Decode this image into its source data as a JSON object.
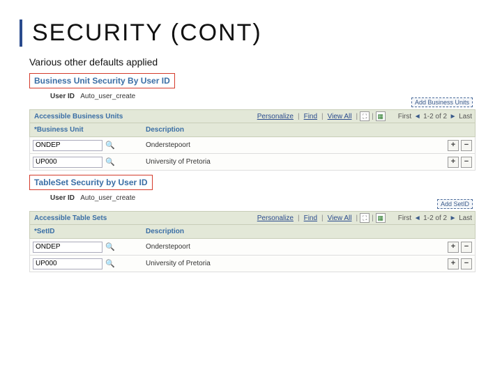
{
  "title": "SECURITY (CONT)",
  "subtitle": "Various other defaults applied",
  "section1": {
    "header": "Business Unit Security By User ID",
    "user_id_label": "User ID",
    "user_id_value": "Auto_user_create",
    "add_button": "Add Business Units",
    "grid_title": "Accessible Business Units",
    "col_a": "*Business Unit",
    "col_b": "Description",
    "rows": [
      {
        "id": "ONDEP",
        "desc": "Onderstepoort"
      },
      {
        "id": "UP000",
        "desc": "University of Pretoria"
      }
    ]
  },
  "section2": {
    "header": "TableSet Security by User ID",
    "user_id_label": "User ID",
    "user_id_value": "Auto_user_create",
    "add_button": "Add SetID",
    "grid_title": "Accessible Table Sets",
    "col_a": "*SetID",
    "col_b": "Description",
    "rows": [
      {
        "id": "ONDEP",
        "desc": "Onderstepoort"
      },
      {
        "id": "UP000",
        "desc": "University of Pretoria"
      }
    ]
  },
  "gridbar": {
    "personalize": "Personalize",
    "find": "Find",
    "view_all": "View All",
    "first": "First",
    "range": "1-2 of 2",
    "last": "Last"
  }
}
